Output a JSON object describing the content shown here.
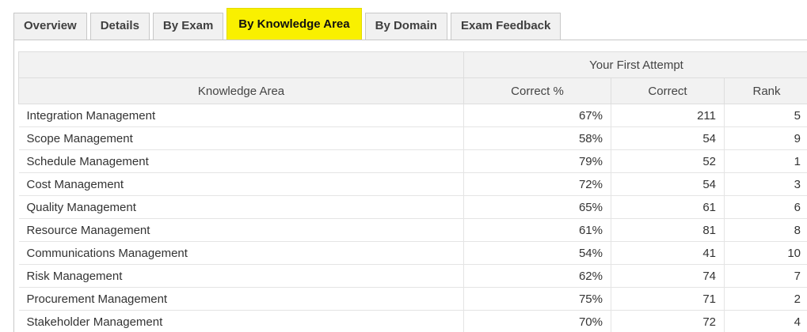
{
  "tabs": [
    {
      "label": "Overview",
      "active": false
    },
    {
      "label": "Details",
      "active": false
    },
    {
      "label": "By Exam",
      "active": false
    },
    {
      "label": "By Knowledge Area",
      "active": true
    },
    {
      "label": "By Domain",
      "active": false
    },
    {
      "label": "Exam Feedback",
      "active": false
    }
  ],
  "table": {
    "group_header": "Your First Attempt",
    "columns": {
      "knowledge_area": "Knowledge Area",
      "correct_pct": "Correct %",
      "correct": "Correct",
      "rank": "Rank"
    },
    "rows": [
      {
        "area": "Integration Management",
        "pct": "67%",
        "correct": "211",
        "rank": "5"
      },
      {
        "area": "Scope Management",
        "pct": "58%",
        "correct": "54",
        "rank": "9"
      },
      {
        "area": "Schedule Management",
        "pct": "79%",
        "correct": "52",
        "rank": "1"
      },
      {
        "area": "Cost Management",
        "pct": "72%",
        "correct": "54",
        "rank": "3"
      },
      {
        "area": "Quality Management",
        "pct": "65%",
        "correct": "61",
        "rank": "6"
      },
      {
        "area": "Resource Management",
        "pct": "61%",
        "correct": "81",
        "rank": "8"
      },
      {
        "area": "Communications Management",
        "pct": "54%",
        "correct": "41",
        "rank": "10"
      },
      {
        "area": "Risk Management",
        "pct": "62%",
        "correct": "74",
        "rank": "7"
      },
      {
        "area": "Procurement Management",
        "pct": "75%",
        "correct": "71",
        "rank": "2"
      },
      {
        "area": "Stakeholder Management",
        "pct": "70%",
        "correct": "72",
        "rank": "4"
      }
    ]
  },
  "colors": {
    "active_tab_highlight": "#f9f000",
    "header_bg": "#f2f2f2"
  }
}
